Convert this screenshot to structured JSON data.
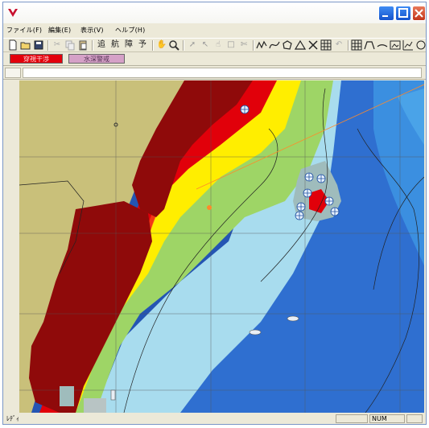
{
  "menu": [
    "ファイル(F)",
    "編集(E)",
    "表示(V)",
    "ヘルプ(H)"
  ],
  "toolbar": {
    "labels": [
      "追",
      "航",
      "障",
      "予"
    ]
  },
  "layers": [
    "穿視干渉",
    "水深警戒"
  ],
  "status": {
    "text": "ﾚﾃﾞｨ",
    "num": "NUM"
  },
  "colors": {
    "land": "#c9c07a",
    "danger_land": "#8f0a0a",
    "red": "#e1000a",
    "orange": "#ff5a1e",
    "yellow": "#ffee00",
    "green": "#9ed566",
    "light_blue": "#a8dcee",
    "mid_blue": "#3b8fe0",
    "deep_blue": "#2455b3"
  }
}
